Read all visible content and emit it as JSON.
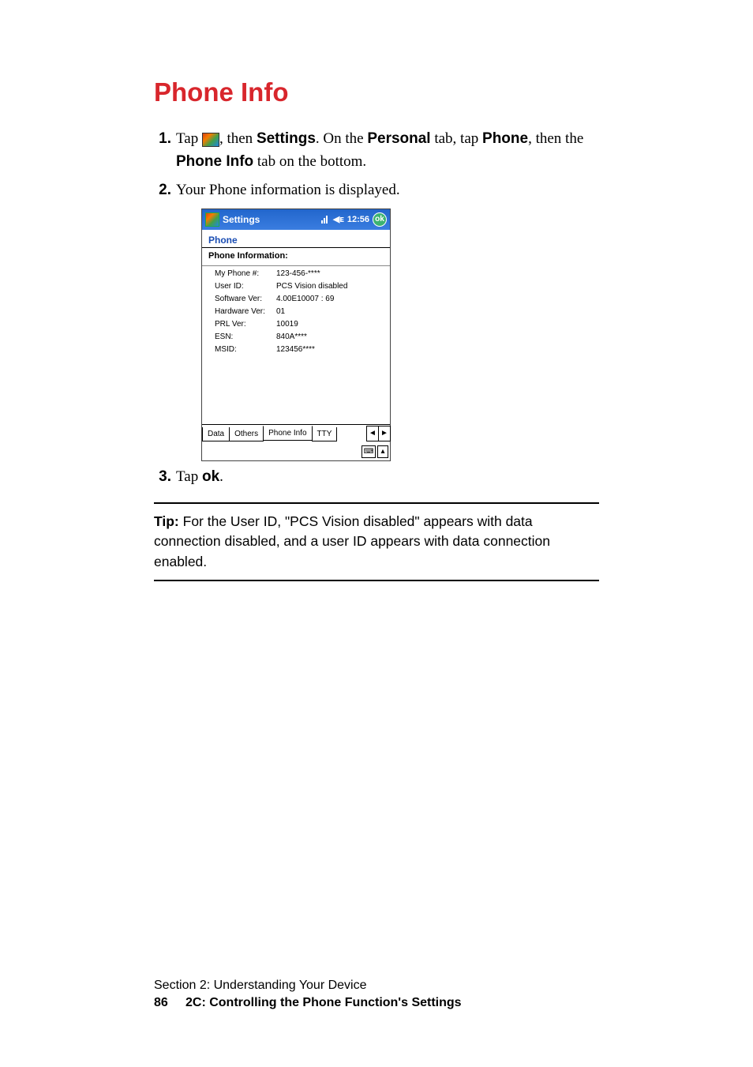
{
  "heading": "Phone Info",
  "steps": {
    "s1": {
      "num": "1.",
      "t1": "Tap ",
      "t2": ", then ",
      "settings": "Settings",
      "t3": ". On the ",
      "personal": "Personal",
      "t4": " tab, tap ",
      "phone": "Phone",
      "t5": ", then the ",
      "phoneinfo": "Phone Info",
      "t6": " tab on the bottom."
    },
    "s2": {
      "num": "2.",
      "text": "Your Phone information is displayed."
    },
    "s3": {
      "num": "3.",
      "t1": "Tap ",
      "ok": "ok",
      "t2": "."
    }
  },
  "screenshot": {
    "titlebar": {
      "title": "Settings",
      "time": "12:56",
      "ok": "ok"
    },
    "phone_label": "Phone",
    "info_header": "Phone Information:",
    "rows": {
      "r0": {
        "l": "My Phone #:",
        "v": "123-456-****"
      },
      "r1": {
        "l": "User ID:",
        "v": "PCS Vision disabled"
      },
      "r2": {
        "l": "Software Ver:",
        "v": "4.00E10007 : 69"
      },
      "r3": {
        "l": "Hardware Ver:",
        "v": "01"
      },
      "r4": {
        "l": "PRL Ver:",
        "v": "10019"
      },
      "r5": {
        "l": "ESN:",
        "v": "840A****"
      },
      "r6": {
        "l": "MSID:",
        "v": "123456****"
      }
    },
    "tabs": {
      "t0": "Data",
      "t1": "Others",
      "t2": "Phone Info",
      "t3": "TTY"
    },
    "arrow_left": "◄",
    "arrow_right": "►",
    "kbd": "⌨",
    "up": "▴"
  },
  "tip": {
    "label": "Tip:",
    "text": " For the User ID, \"PCS Vision disabled\" appears with data connection disabled, and a user ID appears with data connection enabled."
  },
  "footer": {
    "line1": "Section 2: Understanding Your Device",
    "page": "86",
    "line2": "2C: Controlling the Phone Function's Settings"
  }
}
